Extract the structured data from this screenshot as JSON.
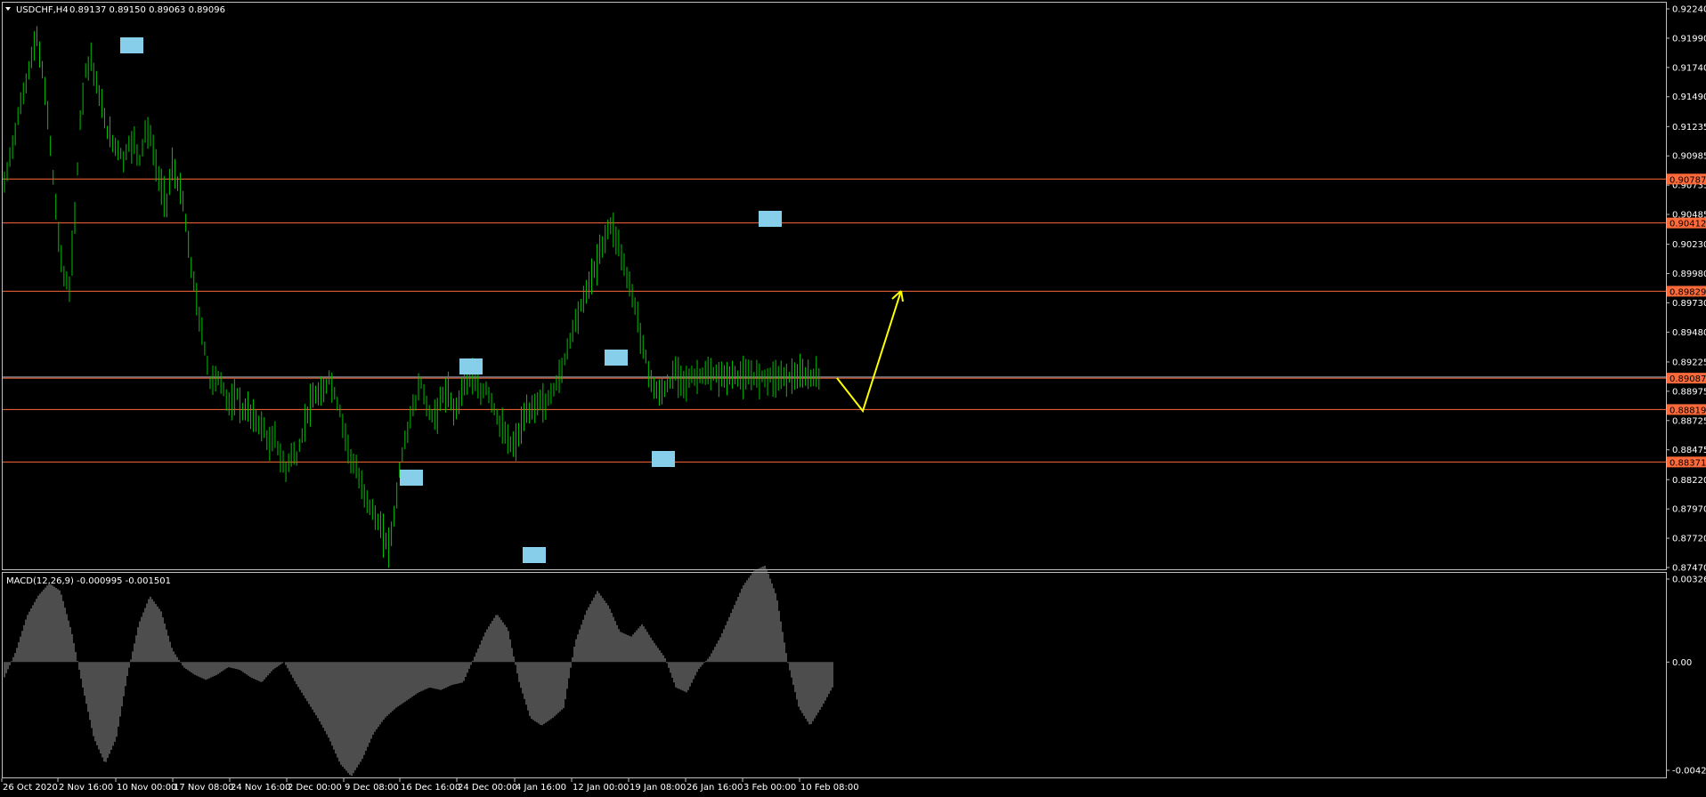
{
  "header": {
    "symbol": "USDCHF,H4",
    "ohlc": "0.89137 0.89150 0.89063 0.89096"
  },
  "macd_header": {
    "label": "MACD(12,26,9) -0.000995 -0.001501"
  },
  "colors": {
    "background": "#000000",
    "frame": "#c0c0c0",
    "candle": "#00c000",
    "level_line": "#ff6a3a",
    "level_tag": "#ff6a3a",
    "current_line": "#a0a8c0",
    "markers": "#87ceeb",
    "arrow": "#ffff00",
    "histogram": "#9a9a9a"
  },
  "chart_data": [
    {
      "type": "line",
      "title": "USDCHF,H4",
      "ylim": [
        0.8747,
        0.9224
      ],
      "y_ticks": [
        "0.92240",
        "0.91990",
        "0.91740",
        "0.91490",
        "0.91235",
        "0.90985",
        "0.90735",
        "0.90485",
        "0.90230",
        "0.89980",
        "0.89730",
        "0.89480",
        "0.89225",
        "0.88975",
        "0.88725",
        "0.88475",
        "0.88220",
        "0.87970",
        "0.87720",
        "0.87470"
      ],
      "x_labels": [
        "26 Oct 2020",
        "2 Nov 16:00",
        "10 Nov 00:00",
        "17 Nov 08:00",
        "24 Nov 16:00",
        "2 Dec 00:00",
        "9 Dec 08:00",
        "16 Dec 16:00",
        "24 Dec 00:00",
        "4 Jan 16:00",
        "12 Jan 00:00",
        "19 Jan 08:00",
        "26 Jan 16:00",
        "3 Feb 00:00",
        "10 Feb 08:00"
      ],
      "x": [
        0,
        6,
        10,
        12,
        14,
        16,
        18,
        20,
        22,
        24,
        26,
        28,
        30,
        32,
        34,
        36,
        38,
        40,
        42,
        44,
        46,
        48,
        50,
        52,
        54,
        56,
        58,
        60,
        62,
        64,
        66,
        68,
        70,
        72,
        74,
        76,
        78,
        80,
        82,
        84,
        86,
        88,
        90,
        92,
        94,
        96,
        98,
        100,
        102,
        104,
        106,
        108,
        110,
        112,
        114,
        116,
        118,
        120,
        122,
        124,
        126,
        128,
        130,
        132,
        134,
        136,
        138,
        140,
        142,
        144,
        146,
        148,
        150,
        152,
        154,
        156,
        158,
        160,
        162,
        164,
        166,
        168,
        170,
        172,
        174,
        176,
        178,
        180,
        182,
        184,
        186,
        188,
        190,
        192,
        194,
        196,
        198,
        200,
        202,
        204,
        206,
        208,
        210,
        212,
        214,
        216,
        218,
        220,
        222,
        224,
        226,
        228,
        230,
        232,
        234,
        236,
        238,
        240,
        242,
        244,
        246,
        248,
        250,
        252,
        254,
        256,
        258,
        260,
        262,
        264,
        266,
        268,
        270,
        272,
        274,
        276,
        278,
        280,
        282,
        284,
        286,
        288,
        290,
        292,
        294,
        296,
        298,
        300,
        302,
        304,
        306
      ],
      "close": [
        0.9074,
        0.9142,
        0.9182,
        0.92,
        0.917,
        0.9135,
        0.908,
        0.903,
        0.8995,
        0.8985,
        0.9045,
        0.913,
        0.9172,
        0.9182,
        0.916,
        0.914,
        0.912,
        0.911,
        0.9105,
        0.9095,
        0.9108,
        0.911,
        0.9095,
        0.912,
        0.9115,
        0.909,
        0.907,
        0.906,
        0.909,
        0.9075,
        0.906,
        0.902,
        0.899,
        0.896,
        0.8935,
        0.8905,
        0.891,
        0.8905,
        0.8892,
        0.8885,
        0.8895,
        0.888,
        0.8882,
        0.8875,
        0.887,
        0.8865,
        0.885,
        0.886,
        0.884,
        0.883,
        0.8845,
        0.884,
        0.886,
        0.888,
        0.889,
        0.8895,
        0.8895,
        0.891,
        0.8895,
        0.888,
        0.886,
        0.884,
        0.883,
        0.8815,
        0.8805,
        0.8795,
        0.8785,
        0.8775,
        0.8765,
        0.879,
        0.883,
        0.8855,
        0.8875,
        0.889,
        0.8905,
        0.8885,
        0.8875,
        0.888,
        0.8895,
        0.8895,
        0.888,
        0.889,
        0.8905,
        0.8915,
        0.8905,
        0.8895,
        0.89,
        0.889,
        0.8875,
        0.8865,
        0.8855,
        0.885,
        0.886,
        0.8875,
        0.888,
        0.8885,
        0.889,
        0.8885,
        0.8895,
        0.8905,
        0.8915,
        0.8935,
        0.895,
        0.8965,
        0.8975,
        0.899,
        0.9,
        0.9015,
        0.903,
        0.904,
        0.903,
        0.9015,
        0.8995,
        0.898,
        0.896,
        0.8935,
        0.8915,
        0.89,
        0.8895,
        0.89,
        0.8905,
        0.8915,
        0.891,
        0.8905,
        0.891,
        0.891,
        0.8912,
        0.8911,
        0.8911,
        0.891,
        0.891,
        0.8911,
        0.891,
        0.891,
        0.8909,
        0.891,
        0.891,
        0.891,
        0.891,
        0.891,
        0.891,
        0.891,
        0.891,
        0.891,
        0.891,
        0.891,
        0.891,
        0.891,
        0.891
      ],
      "levels": [
        {
          "value": 0.90787,
          "tag": "0.90787"
        },
        {
          "value": 0.90412,
          "tag": "0.90412"
        },
        {
          "value": 0.89829,
          "tag": "0.89829"
        },
        {
          "value": 0.89087,
          "tag": "0.89087"
        },
        {
          "value": 0.88819,
          "tag": "0.88819"
        },
        {
          "value": 0.88371,
          "tag": "0.88371"
        }
      ],
      "current_price": 0.89096,
      "current_price_tag": "0.89096"
    },
    {
      "type": "bar",
      "title": "MACD(12,26,9) -0.000995 -0.001501",
      "ylim": [
        -0.004258,
        0.003265
      ],
      "y_ticks": [
        "0.003265",
        "0.00",
        "-0.004258"
      ],
      "values": [
        -0.0006,
        0.0004,
        0.0018,
        0.0026,
        0.0031,
        0.0028,
        0.0012,
        -0.001,
        -0.003,
        -0.004,
        -0.003,
        -0.0005,
        0.0015,
        0.0026,
        0.002,
        0.0005,
        -0.0002,
        -0.0005,
        -0.0007,
        -0.0005,
        -0.0002,
        -0.0003,
        -0.0006,
        -0.0008,
        -0.0003,
        0.0,
        -0.0008,
        -0.0015,
        -0.0022,
        -0.003,
        -0.004,
        -0.0045,
        -0.0038,
        -0.0028,
        -0.0022,
        -0.0018,
        -0.0015,
        -0.0012,
        -0.001,
        -0.0011,
        -0.0009,
        -0.0008,
        0.0002,
        0.0012,
        0.0019,
        0.0013,
        -0.0008,
        -0.0022,
        -0.0025,
        -0.0022,
        -0.0018,
        0.0008,
        0.002,
        0.0028,
        0.0022,
        0.0012,
        0.001,
        0.0015,
        0.0008,
        0.0002,
        -0.001,
        -0.0012,
        -0.0003,
        0.0002,
        0.001,
        0.002,
        0.003,
        0.0036,
        0.0038,
        0.0026,
        0.0,
        -0.0018,
        -0.0025,
        -0.0018,
        -0.001
      ]
    }
  ]
}
